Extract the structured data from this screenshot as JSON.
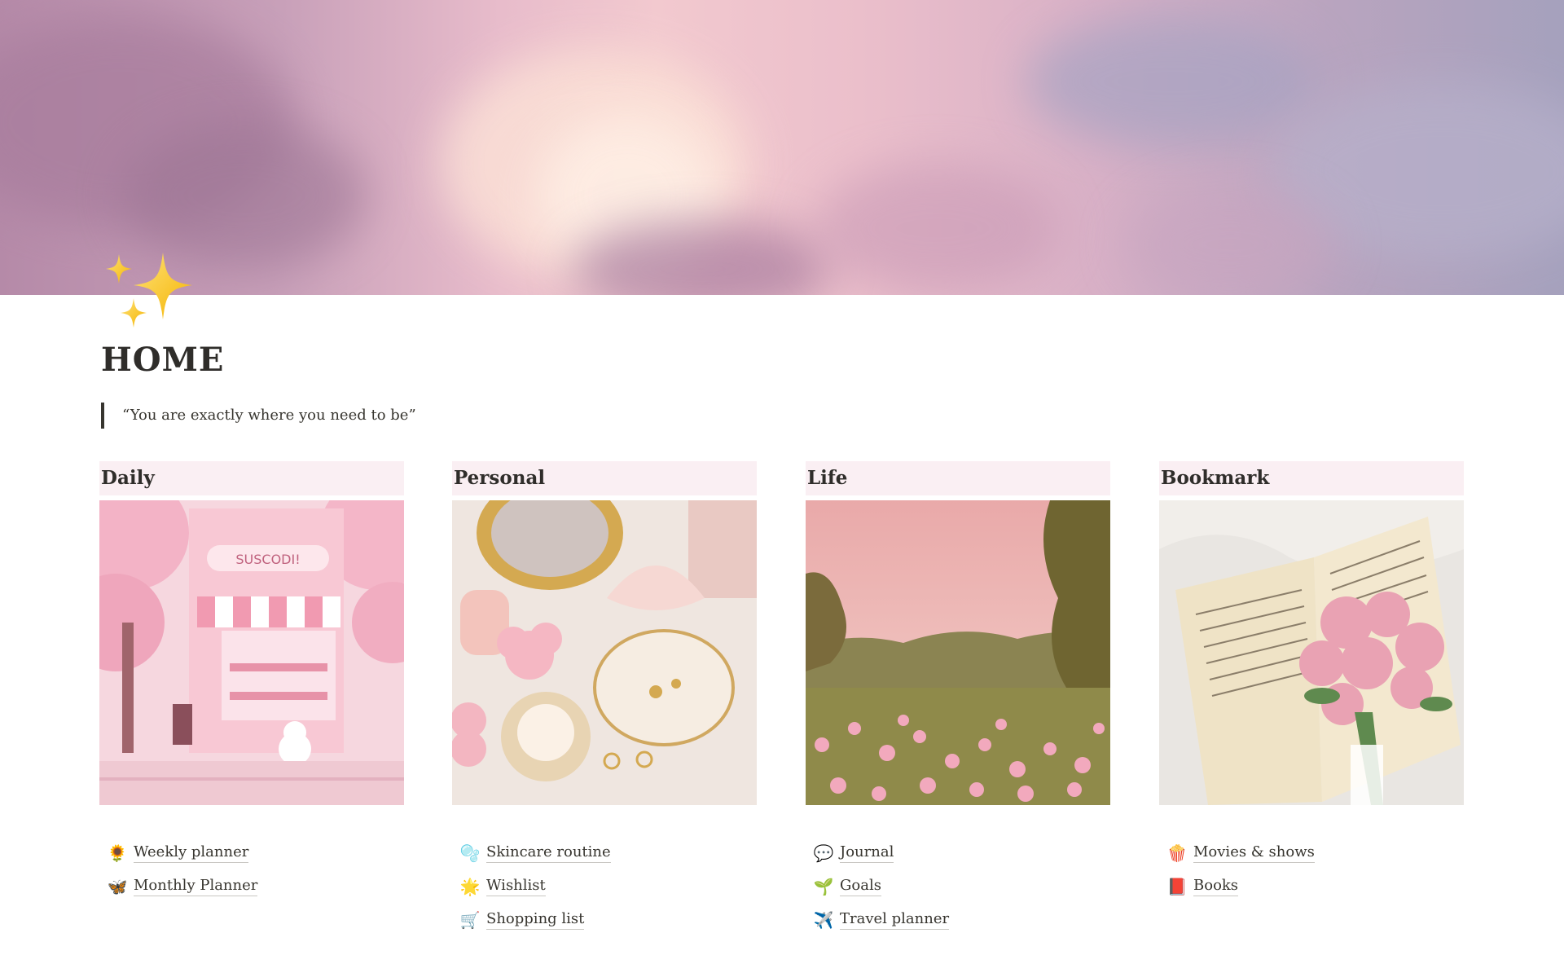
{
  "page": {
    "title": "HOME",
    "quote": "“You are exactly where you need to be”",
    "icon": "sparkles-icon"
  },
  "columns": [
    {
      "header": "Daily",
      "image": "pink-cafe-illustration",
      "links": [
        {
          "icon": "🌻",
          "icon_name": "sunflower-icon",
          "label": "Weekly planner"
        },
        {
          "icon": "🦋",
          "icon_name": "butterfly-icon",
          "label": "Monthly Planner"
        }
      ]
    },
    {
      "header": "Personal",
      "image": "vanity-trinkets-photo",
      "links": [
        {
          "icon": "🫧",
          "icon_name": "bubbles-icon",
          "label": "Skincare routine"
        },
        {
          "icon": "🌟",
          "icon_name": "glowing-star-icon",
          "label": "Wishlist"
        },
        {
          "icon": "🛒",
          "icon_name": "shopping-cart-icon",
          "label": "Shopping list"
        }
      ]
    },
    {
      "header": "Life",
      "image": "pink-flower-field-photo",
      "links": [
        {
          "icon": "💬",
          "icon_name": "speech-bubble-icon",
          "label": "Journal"
        },
        {
          "icon": "🌱",
          "icon_name": "seedling-icon",
          "label": "Goals"
        },
        {
          "icon": "✈️",
          "icon_name": "airplane-icon",
          "label": "Travel planner"
        }
      ]
    },
    {
      "header": "Bookmark",
      "image": "book-and-roses-photo",
      "links": [
        {
          "icon": "🍿",
          "icon_name": "popcorn-icon",
          "label": "Movies & shows"
        },
        {
          "icon": "📕",
          "icon_name": "red-book-icon",
          "label": "Books"
        }
      ]
    }
  ],
  "colors": {
    "header_bg": "#faeff3",
    "text": "#37352f"
  }
}
